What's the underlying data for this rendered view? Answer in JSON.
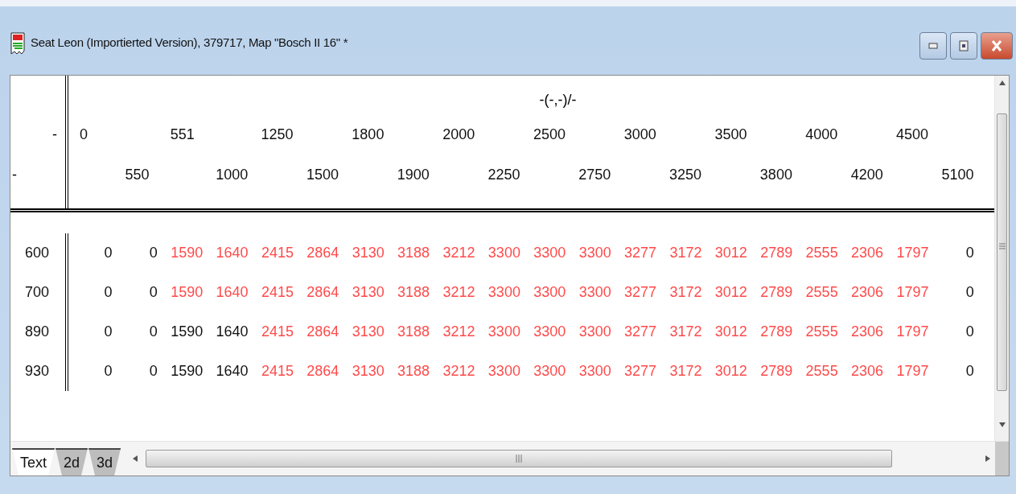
{
  "window": {
    "title": "Seat Leon (Importierted Version), 379717, Map \"Bosch II 16\" *"
  },
  "map": {
    "axis_title": "-(-,-)/-",
    "header_labels": [
      "-",
      "-"
    ],
    "columns": [
      "0",
      "550",
      "551",
      "1000",
      "1250",
      "1500",
      "1800",
      "1900",
      "2000",
      "2250",
      "2500",
      "2750",
      "3000",
      "3250",
      "3500",
      "3800",
      "4000",
      "4200",
      "4500",
      "5100"
    ],
    "rows": [
      {
        "label": "600",
        "cells": [
          {
            "value": "0",
            "highlighted": false
          },
          {
            "value": "0",
            "highlighted": false
          },
          {
            "value": "1590",
            "highlighted": true
          },
          {
            "value": "1640",
            "highlighted": true
          },
          {
            "value": "2415",
            "highlighted": true
          },
          {
            "value": "2864",
            "highlighted": true
          },
          {
            "value": "3130",
            "highlighted": true
          },
          {
            "value": "3188",
            "highlighted": true
          },
          {
            "value": "3212",
            "highlighted": true
          },
          {
            "value": "3300",
            "highlighted": true
          },
          {
            "value": "3300",
            "highlighted": true
          },
          {
            "value": "3300",
            "highlighted": true
          },
          {
            "value": "3277",
            "highlighted": true
          },
          {
            "value": "3172",
            "highlighted": true
          },
          {
            "value": "3012",
            "highlighted": true
          },
          {
            "value": "2789",
            "highlighted": true
          },
          {
            "value": "2555",
            "highlighted": true
          },
          {
            "value": "2306",
            "highlighted": true
          },
          {
            "value": "1797",
            "highlighted": true
          },
          {
            "value": "0",
            "highlighted": false
          }
        ]
      },
      {
        "label": "700",
        "cells": [
          {
            "value": "0",
            "highlighted": false
          },
          {
            "value": "0",
            "highlighted": false
          },
          {
            "value": "1590",
            "highlighted": true
          },
          {
            "value": "1640",
            "highlighted": true
          },
          {
            "value": "2415",
            "highlighted": true
          },
          {
            "value": "2864",
            "highlighted": true
          },
          {
            "value": "3130",
            "highlighted": true
          },
          {
            "value": "3188",
            "highlighted": true
          },
          {
            "value": "3212",
            "highlighted": true
          },
          {
            "value": "3300",
            "highlighted": true
          },
          {
            "value": "3300",
            "highlighted": true
          },
          {
            "value": "3300",
            "highlighted": true
          },
          {
            "value": "3277",
            "highlighted": true
          },
          {
            "value": "3172",
            "highlighted": true
          },
          {
            "value": "3012",
            "highlighted": true
          },
          {
            "value": "2789",
            "highlighted": true
          },
          {
            "value": "2555",
            "highlighted": true
          },
          {
            "value": "2306",
            "highlighted": true
          },
          {
            "value": "1797",
            "highlighted": true
          },
          {
            "value": "0",
            "highlighted": false
          }
        ]
      },
      {
        "label": "890",
        "cells": [
          {
            "value": "0",
            "highlighted": false
          },
          {
            "value": "0",
            "highlighted": false
          },
          {
            "value": "1590",
            "highlighted": false
          },
          {
            "value": "1640",
            "highlighted": false
          },
          {
            "value": "2415",
            "highlighted": true
          },
          {
            "value": "2864",
            "highlighted": true
          },
          {
            "value": "3130",
            "highlighted": true
          },
          {
            "value": "3188",
            "highlighted": true
          },
          {
            "value": "3212",
            "highlighted": true
          },
          {
            "value": "3300",
            "highlighted": true
          },
          {
            "value": "3300",
            "highlighted": true
          },
          {
            "value": "3300",
            "highlighted": true
          },
          {
            "value": "3277",
            "highlighted": true
          },
          {
            "value": "3172",
            "highlighted": true
          },
          {
            "value": "3012",
            "highlighted": true
          },
          {
            "value": "2789",
            "highlighted": true
          },
          {
            "value": "2555",
            "highlighted": true
          },
          {
            "value": "2306",
            "highlighted": true
          },
          {
            "value": "1797",
            "highlighted": true
          },
          {
            "value": "0",
            "highlighted": false
          }
        ]
      },
      {
        "label": "930",
        "cells": [
          {
            "value": "0",
            "highlighted": false
          },
          {
            "value": "0",
            "highlighted": false
          },
          {
            "value": "1590",
            "highlighted": false
          },
          {
            "value": "1640",
            "highlighted": false
          },
          {
            "value": "2415",
            "highlighted": true
          },
          {
            "value": "2864",
            "highlighted": true
          },
          {
            "value": "3130",
            "highlighted": true
          },
          {
            "value": "3188",
            "highlighted": true
          },
          {
            "value": "3212",
            "highlighted": true
          },
          {
            "value": "3300",
            "highlighted": true
          },
          {
            "value": "3300",
            "highlighted": true
          },
          {
            "value": "3300",
            "highlighted": true
          },
          {
            "value": "3277",
            "highlighted": true
          },
          {
            "value": "3172",
            "highlighted": true
          },
          {
            "value": "3012",
            "highlighted": true
          },
          {
            "value": "2789",
            "highlighted": true
          },
          {
            "value": "2555",
            "highlighted": true
          },
          {
            "value": "2306",
            "highlighted": true
          },
          {
            "value": "1797",
            "highlighted": true
          },
          {
            "value": "0",
            "highlighted": false
          }
        ]
      }
    ]
  },
  "tabs": [
    {
      "label": "Text",
      "selected": true
    },
    {
      "label": "2d",
      "selected": false
    },
    {
      "label": "3d",
      "selected": false
    }
  ]
}
